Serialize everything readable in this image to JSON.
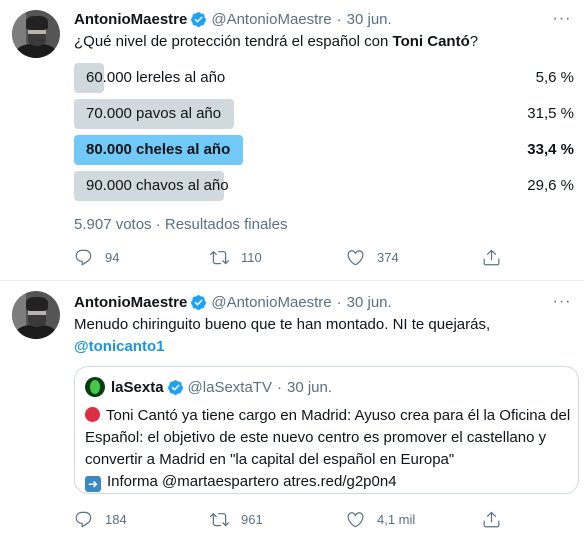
{
  "tweet1": {
    "author_name": "AntonioMaestre",
    "handle": "@AntonioMaestre",
    "separator": "·",
    "date": "30 jun.",
    "text_prefix": "¿Qué nivel de protección tendrá el español con ",
    "text_bold": "Toni Cantó",
    "text_suffix": "?",
    "poll": {
      "options": [
        {
          "label": "60.000 lereles al año",
          "percent_text": "5,6 %",
          "percent": 5.6,
          "winner": false
        },
        {
          "label": "70.000 pavos al año",
          "percent_text": "31,5 %",
          "percent": 31.5,
          "winner": false
        },
        {
          "label": "80.000 cheles al año",
          "percent_text": "33,4 %",
          "percent": 33.4,
          "winner": true
        },
        {
          "label": "90.000 chavos al año",
          "percent_text": "29,6 %",
          "percent": 29.6,
          "winner": false
        }
      ],
      "footer": "5.907 votos · Resultados finales"
    },
    "actions": {
      "replies": "94",
      "retweets": "110",
      "likes": "374"
    }
  },
  "tweet2": {
    "author_name": "AntonioMaestre",
    "handle": "@AntonioMaestre",
    "separator": "·",
    "date": "30 jun.",
    "text": "Menudo chiringuito bueno que te han montado. NI te quejarás,",
    "mention": "@tonicanto1",
    "quote": {
      "name": "laSexta",
      "handle": "@laSextaTV",
      "separator": "·",
      "date": "30 jun.",
      "line1": "Toni Cantó ya tiene cargo en Madrid: Ayuso crea para él la Oficina del Español: el objetivo de este nuevo centro es promover el castellano y convertir a Madrid en \"la capital del español en Europa\"",
      "line2": "Informa @martaespartero  atres.red/g2p0n4"
    },
    "actions": {
      "replies": "184",
      "retweets": "961",
      "likes": "4,1 mil"
    }
  },
  "icons": {
    "verified": "verified-badge-icon",
    "more": "more-icon",
    "reply": "reply-icon",
    "retweet": "retweet-icon",
    "like": "like-icon",
    "share": "share-icon"
  },
  "colors": {
    "accent": "#1b95e0",
    "poll_bar": "#cfd9de",
    "poll_winner": "#71c9f8",
    "muted": "#5b7083"
  }
}
